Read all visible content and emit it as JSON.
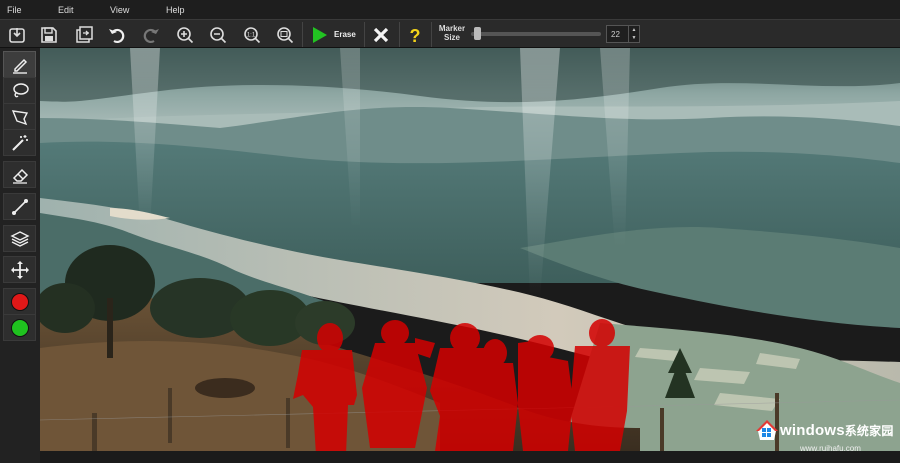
{
  "menu": {
    "file": "File",
    "edit": "Edit",
    "view": "View",
    "help": "Help"
  },
  "toolbar": {
    "buttons": [
      "import-icon",
      "save-icon",
      "export-icon",
      "undo-icon",
      "redo-icon",
      "zoom-in-icon",
      "zoom-out-icon",
      "zoom-actual-icon",
      "zoom-fit-icon"
    ],
    "erase_label": "Erase",
    "marker_size_label_line1": "Marker",
    "marker_size_label_line2": "Size",
    "marker_size_value": "22",
    "marker_size_level": 0.02
  },
  "tools": [
    "brush-icon",
    "lasso-icon",
    "polygon-lasso-icon",
    "magic-wand-icon",
    "eraser-icon",
    "line-icon",
    "layers-icon",
    "move-icon"
  ],
  "colors": {
    "foreground": "#e01818",
    "background": "#1fc21f",
    "mask": "#d40000"
  },
  "watermark": {
    "brand": "windows",
    "suffix": "系统家园",
    "url": "www.ruihafu.com"
  }
}
